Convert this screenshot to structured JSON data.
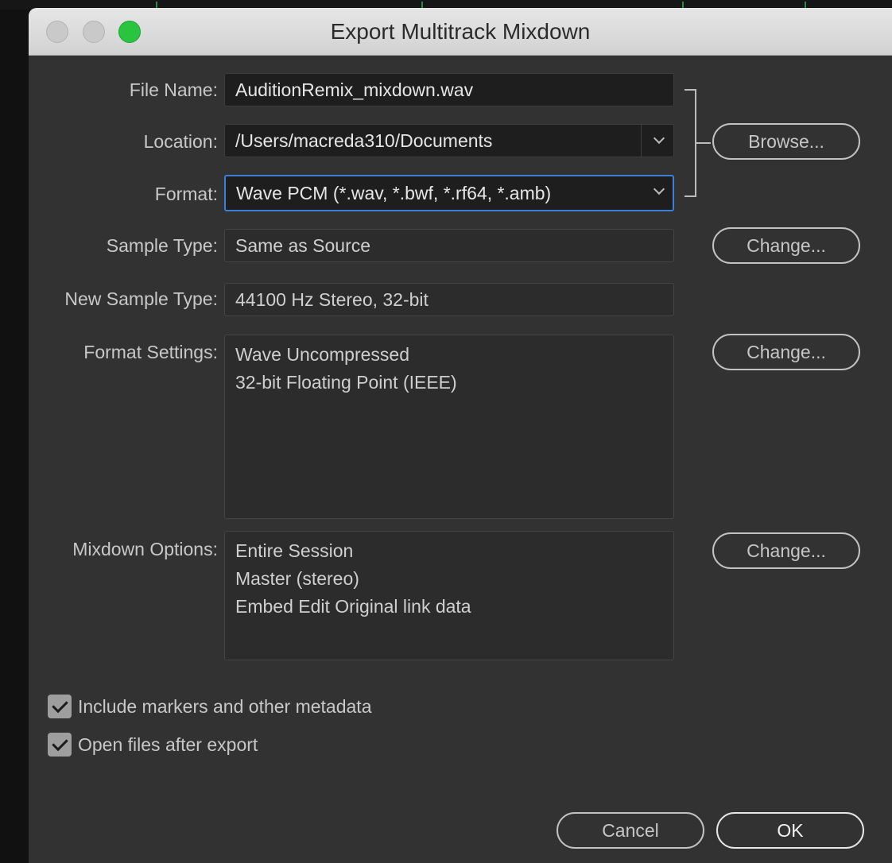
{
  "window": {
    "title": "Export Multitrack Mixdown"
  },
  "form": {
    "file_name": {
      "label": "File Name:",
      "value": "AuditionRemix_mixdown.wav"
    },
    "location": {
      "label": "Location:",
      "value": "/Users/macreda310/Documents"
    },
    "format": {
      "label": "Format:",
      "value": "Wave PCM (*.wav, *.bwf, *.rf64, *.amb)"
    },
    "sample_type": {
      "label": "Sample Type:",
      "value": "Same as Source"
    },
    "new_sample_type": {
      "label": "New Sample Type:",
      "value": "44100 Hz Stereo, 32-bit"
    },
    "format_settings": {
      "label": "Format Settings:",
      "lines": [
        "Wave Uncompressed",
        "32-bit Floating Point (IEEE)"
      ]
    },
    "mixdown_options": {
      "label": "Mixdown Options:",
      "lines": [
        "Entire Session",
        "Master (stereo)",
        "Embed Edit Original link data"
      ]
    }
  },
  "buttons": {
    "browse": "Browse...",
    "change_sample_type": "Change...",
    "change_format_settings": "Change...",
    "change_mixdown_options": "Change...",
    "cancel": "Cancel",
    "ok": "OK"
  },
  "checkboxes": {
    "include_markers": {
      "label": "Include markers and other metadata",
      "checked": true
    },
    "open_files": {
      "label": "Open files after export",
      "checked": true
    }
  },
  "colors": {
    "accent_focus": "#3d7fd6",
    "traffic_green": "#29c541",
    "panel_bg": "#323232"
  }
}
